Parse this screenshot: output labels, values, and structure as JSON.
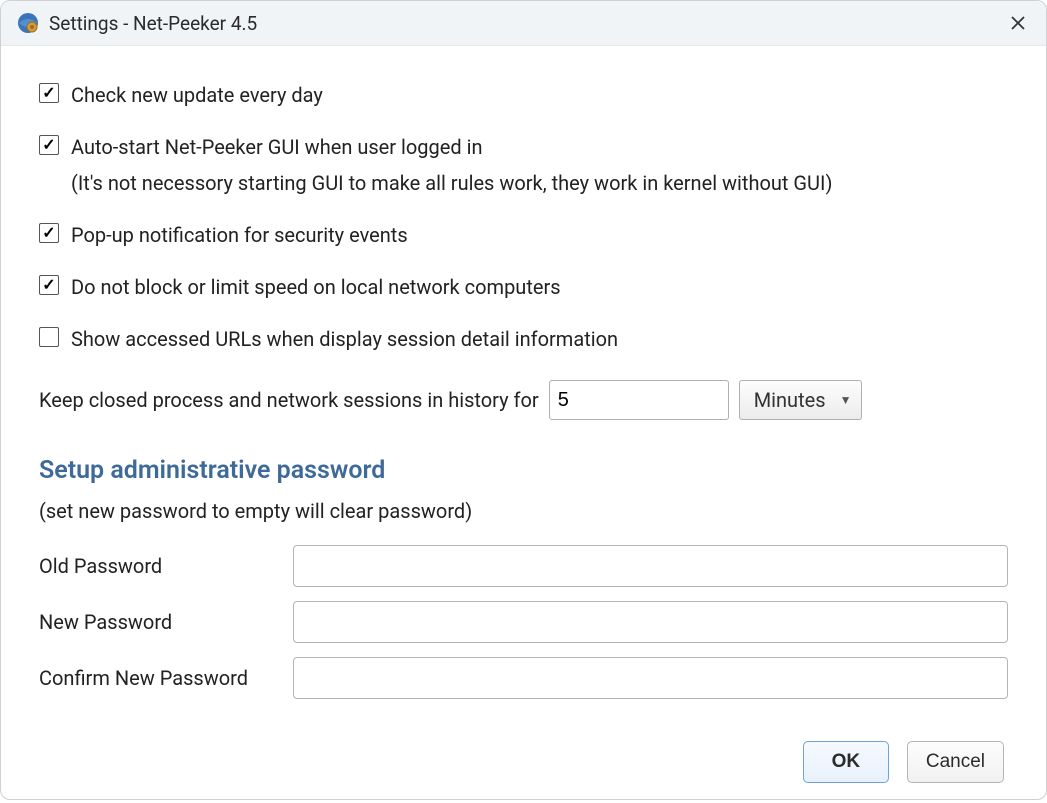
{
  "window": {
    "title": "Settings - Net-Peeker 4.5"
  },
  "options": {
    "check_update": {
      "label": "Check new update every day",
      "checked": true
    },
    "auto_start": {
      "label": "Auto-start Net-Peeker GUI when user logged in",
      "sublabel": "(It's not necessory starting GUI to make all rules work, they work in kernel without GUI)",
      "checked": true
    },
    "popup_notification": {
      "label": "Pop-up notification for security events",
      "checked": true
    },
    "no_block_local": {
      "label": "Do not block or limit speed on local network computers",
      "checked": true
    },
    "show_urls": {
      "label": "Show accessed URLs when display session detail information",
      "checked": false
    }
  },
  "history": {
    "label": "Keep closed process and network sessions in history for",
    "value": "5",
    "unit": "Minutes"
  },
  "password_section": {
    "heading": "Setup administrative password",
    "subtext": "(set new password to empty will clear password)",
    "old_label": "Old Password",
    "new_label": "New Password",
    "confirm_label": "Confirm New Password",
    "old_value": "",
    "new_value": "",
    "confirm_value": ""
  },
  "buttons": {
    "ok": "OK",
    "cancel": "Cancel"
  }
}
